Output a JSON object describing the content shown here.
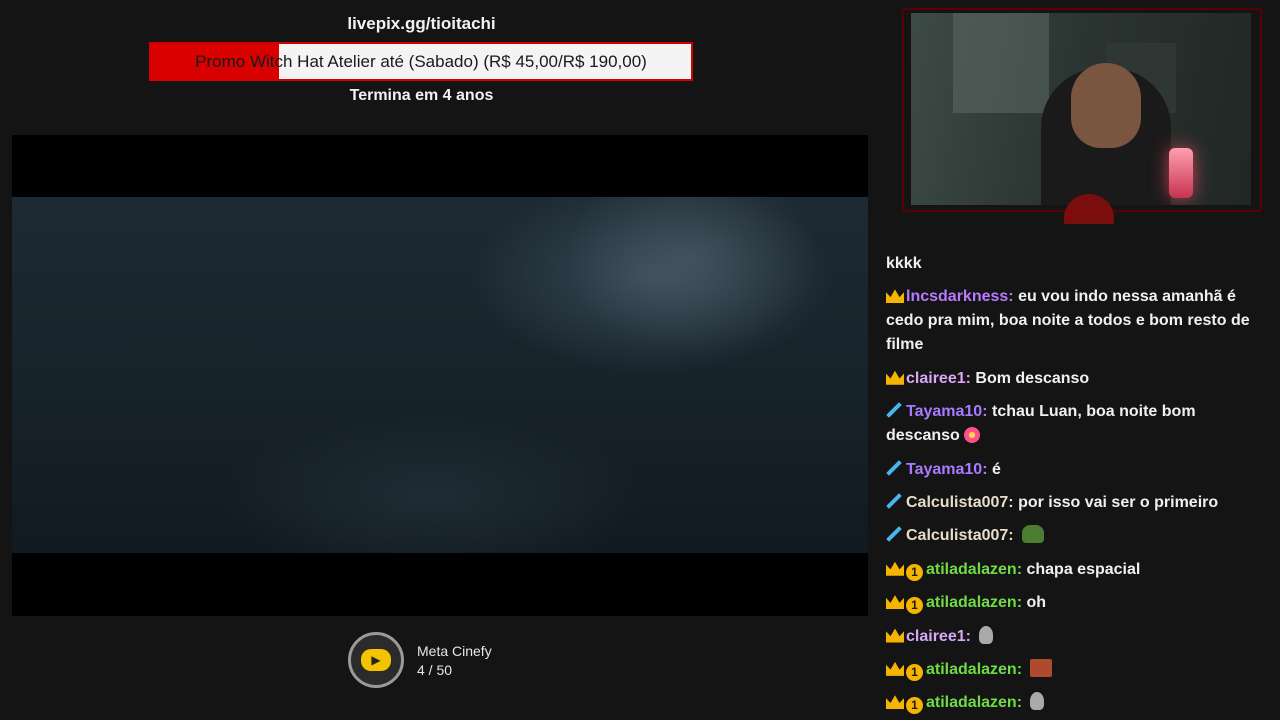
{
  "overlay": {
    "donation_url": "livepix.gg/tioitachi",
    "goal_text": "Promo Witch Hat Atelier até (Sabado) (R$ 45,00/R$ 190,00)",
    "goal_progress": 0.237,
    "goal_ends": "Termina em 4 anos",
    "colors": {
      "fill": "#d80000",
      "track": "#f4f4f4"
    }
  },
  "meta": {
    "icon": "cinefy-logo-icon",
    "label": "Meta Cinefy",
    "count": "4 / 50"
  },
  "chat": {
    "messages": [
      {
        "badges": [],
        "user": "",
        "user_color": "#ffffff",
        "text": "kkkk"
      },
      {
        "badges": [
          "crown"
        ],
        "user": "lncsdarkness:",
        "user_color": "#b87aff",
        "text": "eu vou indo nessa amanhã é cedo pra mim, boa noite a todos e bom resto de filme"
      },
      {
        "badges": [
          "crown"
        ],
        "user": "clairee1:",
        "user_color": "#d9a7f5",
        "text": "Bom descanso"
      },
      {
        "badges": [
          "sword"
        ],
        "user": "Tayama10:",
        "user_color": "#a77bff",
        "text": "tchau Luan, boa noite bom descanso",
        "emote": "flower"
      },
      {
        "badges": [
          "sword"
        ],
        "user": "Tayama10:",
        "user_color": "#a77bff",
        "text": "é"
      },
      {
        "badges": [
          "sword"
        ],
        "user": "Calculista007:",
        "user_color": "#e8dccb",
        "text": "por isso vai ser o primeiro"
      },
      {
        "badges": [
          "sword"
        ],
        "user": "Calculista007:",
        "user_color": "#e8dccb",
        "text": "",
        "emote": "frog"
      },
      {
        "badges": [
          "crown",
          "one"
        ],
        "user": "atiladalazen:",
        "user_color": "#6fdc46",
        "text": "chapa espacial"
      },
      {
        "badges": [
          "crown",
          "one"
        ],
        "user": "atiladalazen:",
        "user_color": "#6fdc46",
        "text": "oh"
      },
      {
        "badges": [
          "crown"
        ],
        "user": "clairee1:",
        "user_color": "#d9a7f5",
        "text": "",
        "emote": "ghost"
      },
      {
        "badges": [
          "crown",
          "one"
        ],
        "user": "atiladalazen:",
        "user_color": "#6fdc46",
        "text": "",
        "emote": "face"
      },
      {
        "badges": [
          "crown",
          "one"
        ],
        "user": "atiladalazen:",
        "user_color": "#6fdc46",
        "text": "",
        "emote": "ghost"
      }
    ]
  }
}
